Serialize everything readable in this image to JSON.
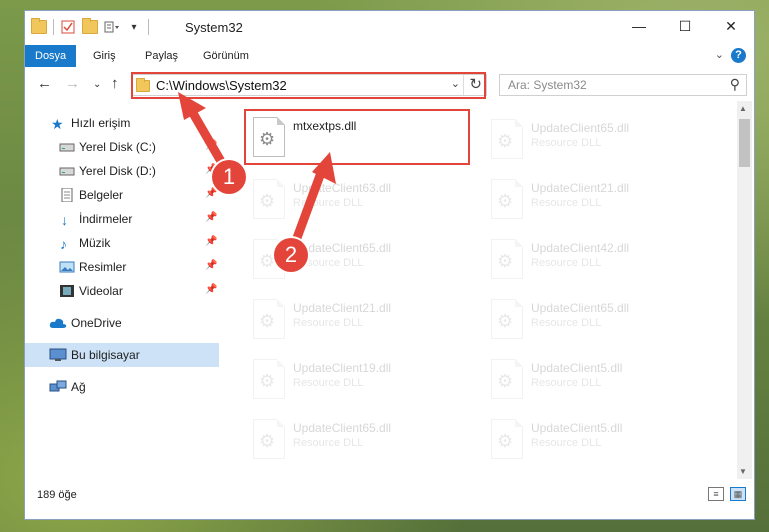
{
  "window": {
    "title": "System32"
  },
  "ribbon": {
    "tabs": [
      "Dosya",
      "Giriş",
      "Paylaş",
      "Görünüm"
    ]
  },
  "address": {
    "path": "C:\\Windows\\System32"
  },
  "search": {
    "placeholder": "Ara: System32"
  },
  "sidebar": {
    "items": [
      {
        "label": "Hızlı erişim"
      },
      {
        "label": "Yerel Disk (C:)"
      },
      {
        "label": "Yerel Disk (D:)"
      },
      {
        "label": "Belgeler"
      },
      {
        "label": "İndirmeler"
      },
      {
        "label": "Müzik"
      },
      {
        "label": "Resimler"
      },
      {
        "label": "Videolar"
      },
      {
        "label": "OneDrive"
      },
      {
        "label": "Bu bilgisayar"
      },
      {
        "label": "Ağ"
      }
    ]
  },
  "files": {
    "highlighted": {
      "name": "mtxextps.dll",
      "type": ""
    },
    "left": [
      {
        "name": "UpdateClient63.dll",
        "type": "Resource DLL"
      },
      {
        "name": "UpdateClient65.dll",
        "type": "Resource DLL"
      },
      {
        "name": "UpdateClient21.dll",
        "type": "Resource DLL"
      },
      {
        "name": "UpdateClient19.dll",
        "type": "Resource DLL"
      },
      {
        "name": "UpdateClient65.dll",
        "type": "Resource DLL"
      }
    ],
    "right": [
      {
        "name": "UpdateClient65.dll",
        "type": "Resource DLL"
      },
      {
        "name": "UpdateClient21.dll",
        "type": "Resource DLL"
      },
      {
        "name": "UpdateClient42.dll",
        "type": "Resource DLL"
      },
      {
        "name": "UpdateClient65.dll",
        "type": "Resource DLL"
      },
      {
        "name": "UpdateClient5.dll",
        "type": "Resource DLL"
      },
      {
        "name": "UpdateClient5.dll",
        "type": "Resource DLL"
      }
    ]
  },
  "status": {
    "count": "189 öğe"
  },
  "annotations": {
    "step1": "1",
    "step2": "2"
  },
  "colors": {
    "accent": "#1979ca",
    "highlight": "#e3453a",
    "selected": "#cde2f7"
  }
}
